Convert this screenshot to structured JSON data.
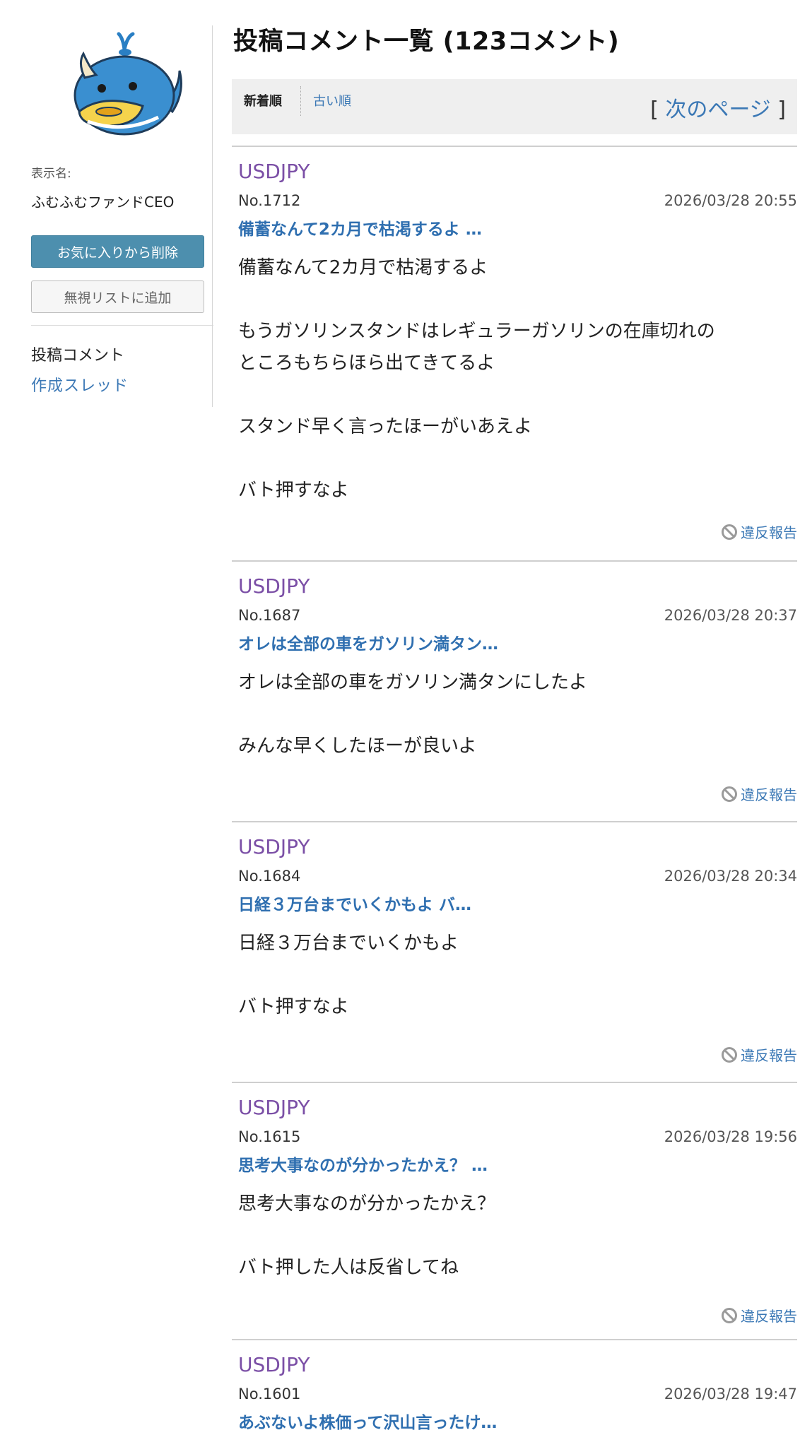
{
  "sidebar": {
    "display_label": "表示名:",
    "display_name": "ふむふむファンドCEO",
    "favorite_button": "お気に入りから削除",
    "ignore_button": "無視リストに追加",
    "nav": {
      "current": "投稿コメント",
      "threads_link": "作成スレッド"
    }
  },
  "main": {
    "title": "投稿コメント一覧 (123コメント)",
    "sort": {
      "newest": "新着順",
      "oldest": "古い順"
    },
    "next_page": {
      "open": "[",
      "label": "次のページ",
      "close": "]"
    },
    "report_label": "違反報告",
    "comments": [
      {
        "user": "USDJPY",
        "no": "No.1712",
        "date": "2026/03/28 20:55",
        "title": "備蓄なんて2カ月で枯渇するよ …",
        "body": [
          "備蓄なんて2カ月で枯渇するよ",
          "",
          "もうガソリンスタンドはレギュラーガソリンの在庫切れの",
          "ところもちらほら出てきてるよ",
          "",
          "スタンド早く言ったほーがいあえよ",
          "",
          "バト押すなよ"
        ]
      },
      {
        "user": "USDJPY",
        "no": "No.1687",
        "date": "2026/03/28 20:37",
        "title": "オレは全部の車をガソリン満タン…",
        "body": [
          "オレは全部の車をガソリン満タンにしたよ",
          "",
          "みんな早くしたほーが良いよ"
        ]
      },
      {
        "user": "USDJPY",
        "no": "No.1684",
        "date": "2026/03/28 20:34",
        "title": "日経３万台までいくかもよ バ…",
        "body": [
          "日経３万台までいくかもよ",
          "",
          "バト押すなよ"
        ]
      },
      {
        "user": "USDJPY",
        "no": "No.1615",
        "date": "2026/03/28 19:56",
        "title": "思考大事なのが分かったかえ？ …",
        "body": [
          "思考大事なのが分かったかえ？",
          "",
          "バト押した人は反省してね"
        ]
      },
      {
        "user": "USDJPY",
        "no": "No.1601",
        "date": "2026/03/28 19:47",
        "title": "あぶないよ株価って沢山言ったけ…",
        "body": []
      }
    ]
  },
  "colors": {
    "link": "#3b78b5",
    "username": "#7b4fa6",
    "title_link": "#2f6fb0",
    "primary_button": "#4d8fae",
    "sort_bar": "#efefef"
  },
  "icons": {
    "avatar": "blue-whale-mascot",
    "report": "prohibited-circle-icon"
  }
}
